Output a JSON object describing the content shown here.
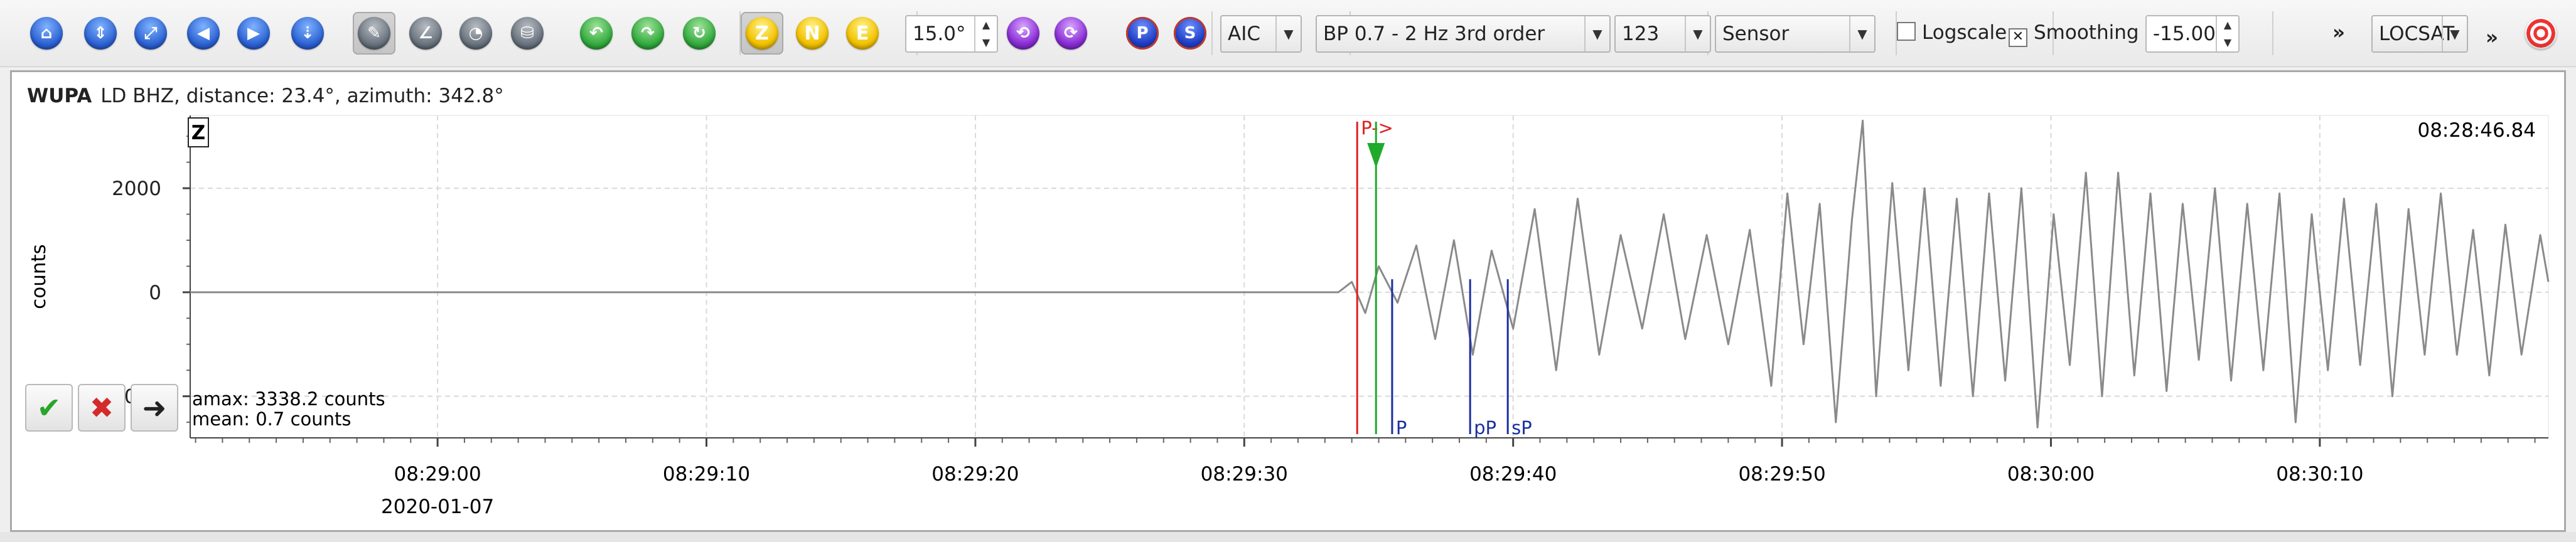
{
  "toolbar": {
    "icons": [
      {
        "name": "home-icon"
      },
      {
        "name": "zoom-in-vertical-icon"
      },
      {
        "name": "zoom-fit-icon"
      },
      {
        "name": "scroll-left-icon"
      },
      {
        "name": "scroll-right-icon"
      },
      {
        "name": "zoom-out-vertical-icon"
      },
      {
        "name": "pick-tool-icon"
      },
      {
        "name": "measure-tool-icon"
      },
      {
        "name": "pan-tool-icon"
      },
      {
        "name": "filter-tool-icon"
      },
      {
        "name": "prev-phase-icon"
      },
      {
        "name": "next-phase-icon"
      },
      {
        "name": "compute-icon"
      }
    ],
    "component_buttons": [
      "Z",
      "N",
      "E"
    ],
    "tilt_value": "15.0°",
    "phase_buttons": [
      "P",
      "S"
    ],
    "picker": "AIC",
    "filter": "BP 0.7 - 2 Hz  3rd order",
    "channel": "123",
    "unit": "Sensor",
    "logscale_label": "Logscale",
    "logscale_checked": false,
    "smoothing_label": "Smoothing",
    "smoothing_checked": true,
    "offset_value": "-15.00",
    "overflow1": "»",
    "locator": "LOCSAT",
    "overflow2": "»"
  },
  "trace": {
    "station": "WUPA",
    "info": "LD  BHZ, distance: 23.4°, azimuth: 342.8°",
    "component": "Z",
    "ylabel": "counts",
    "start_time": "08:28:46.84",
    "amax": "amax: 3338.2 counts",
    "mean": "mean: 0.7 counts",
    "date": "2020-01-07"
  },
  "chart_data": {
    "type": "line",
    "ylabel": "counts",
    "y_ticks": [
      2000,
      0,
      -2000
    ],
    "ylim": [
      -2800,
      3400
    ],
    "x_ticks": [
      "08:29:00",
      "08:29:10",
      "08:29:20",
      "08:29:30",
      "08:29:40",
      "08:29:50",
      "08:30:00",
      "08:30:10"
    ],
    "xlim_seconds_from_0829": [
      -9.2,
      78.5
    ],
    "series": [
      {
        "seconds_from_0829": -9.2,
        "counts": 0
      },
      {
        "seconds_from_0829": 33.5,
        "counts": 0
      },
      {
        "seconds_from_0829": 34.0,
        "counts": 200
      },
      {
        "seconds_from_0829": 34.5,
        "counts": -400
      },
      {
        "seconds_from_0829": 35.0,
        "counts": 500
      },
      {
        "seconds_from_0829": 35.7,
        "counts": -200
      },
      {
        "seconds_from_0829": 36.4,
        "counts": 900
      },
      {
        "seconds_from_0829": 37.1,
        "counts": -900
      },
      {
        "seconds_from_0829": 37.8,
        "counts": 1000
      },
      {
        "seconds_from_0829": 38.5,
        "counts": -1200
      },
      {
        "seconds_from_0829": 39.2,
        "counts": 800
      },
      {
        "seconds_from_0829": 40.0,
        "counts": -700
      },
      {
        "seconds_from_0829": 40.8,
        "counts": 1600
      },
      {
        "seconds_from_0829": 41.6,
        "counts": -1500
      },
      {
        "seconds_from_0829": 42.4,
        "counts": 1800
      },
      {
        "seconds_from_0829": 43.2,
        "counts": -1200
      },
      {
        "seconds_from_0829": 44.0,
        "counts": 1100
      },
      {
        "seconds_from_0829": 44.8,
        "counts": -700
      },
      {
        "seconds_from_0829": 45.6,
        "counts": 1500
      },
      {
        "seconds_from_0829": 46.4,
        "counts": -900
      },
      {
        "seconds_from_0829": 47.2,
        "counts": 1100
      },
      {
        "seconds_from_0829": 48.0,
        "counts": -1000
      },
      {
        "seconds_from_0829": 48.8,
        "counts": 1200
      },
      {
        "seconds_from_0829": 49.6,
        "counts": -1800
      },
      {
        "seconds_from_0829": 50.2,
        "counts": 1900
      },
      {
        "seconds_from_0829": 50.8,
        "counts": -1000
      },
      {
        "seconds_from_0829": 51.4,
        "counts": 1700
      },
      {
        "seconds_from_0829": 52.0,
        "counts": -2500
      },
      {
        "seconds_from_0829": 52.6,
        "counts": 1400
      },
      {
        "seconds_from_0829": 53.0,
        "counts": 3300
      },
      {
        "seconds_from_0829": 53.5,
        "counts": -2000
      },
      {
        "seconds_from_0829": 54.1,
        "counts": 2100
      },
      {
        "seconds_from_0829": 54.7,
        "counts": -1500
      },
      {
        "seconds_from_0829": 55.3,
        "counts": 2000
      },
      {
        "seconds_from_0829": 55.9,
        "counts": -1800
      },
      {
        "seconds_from_0829": 56.5,
        "counts": 1800
      },
      {
        "seconds_from_0829": 57.1,
        "counts": -2000
      },
      {
        "seconds_from_0829": 57.7,
        "counts": 1900
      },
      {
        "seconds_from_0829": 58.3,
        "counts": -1700
      },
      {
        "seconds_from_0829": 58.9,
        "counts": 2000
      },
      {
        "seconds_from_0829": 59.5,
        "counts": -2600
      },
      {
        "seconds_from_0829": 60.1,
        "counts": 1500
      },
      {
        "seconds_from_0829": 60.7,
        "counts": -1400
      },
      {
        "seconds_from_0829": 61.3,
        "counts": 2300
      },
      {
        "seconds_from_0829": 61.9,
        "counts": -2000
      },
      {
        "seconds_from_0829": 62.5,
        "counts": 2300
      },
      {
        "seconds_from_0829": 63.1,
        "counts": -1600
      },
      {
        "seconds_from_0829": 63.7,
        "counts": 1900
      },
      {
        "seconds_from_0829": 64.3,
        "counts": -1900
      },
      {
        "seconds_from_0829": 64.9,
        "counts": 1700
      },
      {
        "seconds_from_0829": 65.5,
        "counts": -1300
      },
      {
        "seconds_from_0829": 66.1,
        "counts": 2000
      },
      {
        "seconds_from_0829": 66.7,
        "counts": -1700
      },
      {
        "seconds_from_0829": 67.3,
        "counts": 1700
      },
      {
        "seconds_from_0829": 67.9,
        "counts": -1500
      },
      {
        "seconds_from_0829": 68.5,
        "counts": 1900
      },
      {
        "seconds_from_0829": 69.1,
        "counts": -2500
      },
      {
        "seconds_from_0829": 69.7,
        "counts": 1500
      },
      {
        "seconds_from_0829": 70.3,
        "counts": -1500
      },
      {
        "seconds_from_0829": 70.9,
        "counts": 1800
      },
      {
        "seconds_from_0829": 71.5,
        "counts": -1400
      },
      {
        "seconds_from_0829": 72.1,
        "counts": 1700
      },
      {
        "seconds_from_0829": 72.7,
        "counts": -2000
      },
      {
        "seconds_from_0829": 73.3,
        "counts": 1600
      },
      {
        "seconds_from_0829": 73.9,
        "counts": -1200
      },
      {
        "seconds_from_0829": 74.5,
        "counts": 1900
      },
      {
        "seconds_from_0829": 75.1,
        "counts": -1200
      },
      {
        "seconds_from_0829": 75.7,
        "counts": 1200
      },
      {
        "seconds_from_0829": 76.3,
        "counts": -1600
      },
      {
        "seconds_from_0829": 76.9,
        "counts": 1300
      },
      {
        "seconds_from_0829": 77.5,
        "counts": -1200
      },
      {
        "seconds_from_0829": 78.2,
        "counts": 1100
      },
      {
        "seconds_from_0829": 78.5,
        "counts": 200
      }
    ],
    "picks": [
      {
        "label": "P",
        "seconds_from_0829": 34.2,
        "color": "#e02020",
        "kind": "manual"
      },
      {
        "label": "",
        "seconds_from_0829": 34.9,
        "color": "#1faa2a",
        "kind": "automatic"
      },
      {
        "label": "P",
        "seconds_from_0829": 35.5,
        "color": "#1a2fa0",
        "kind": "theoretical"
      },
      {
        "label": "pP",
        "seconds_from_0829": 38.4,
        "color": "#1a2fa0",
        "kind": "theoretical"
      },
      {
        "label": "sP",
        "seconds_from_0829": 39.8,
        "color": "#1a2fa0",
        "kind": "theoretical"
      }
    ],
    "manual_pick_marker": "P->"
  },
  "colors": {
    "trace": "#8a8a8a",
    "grid": "#d9d9d9",
    "manual": "#e02020",
    "auto": "#1faa2a",
    "theory": "#1a2fa0"
  }
}
